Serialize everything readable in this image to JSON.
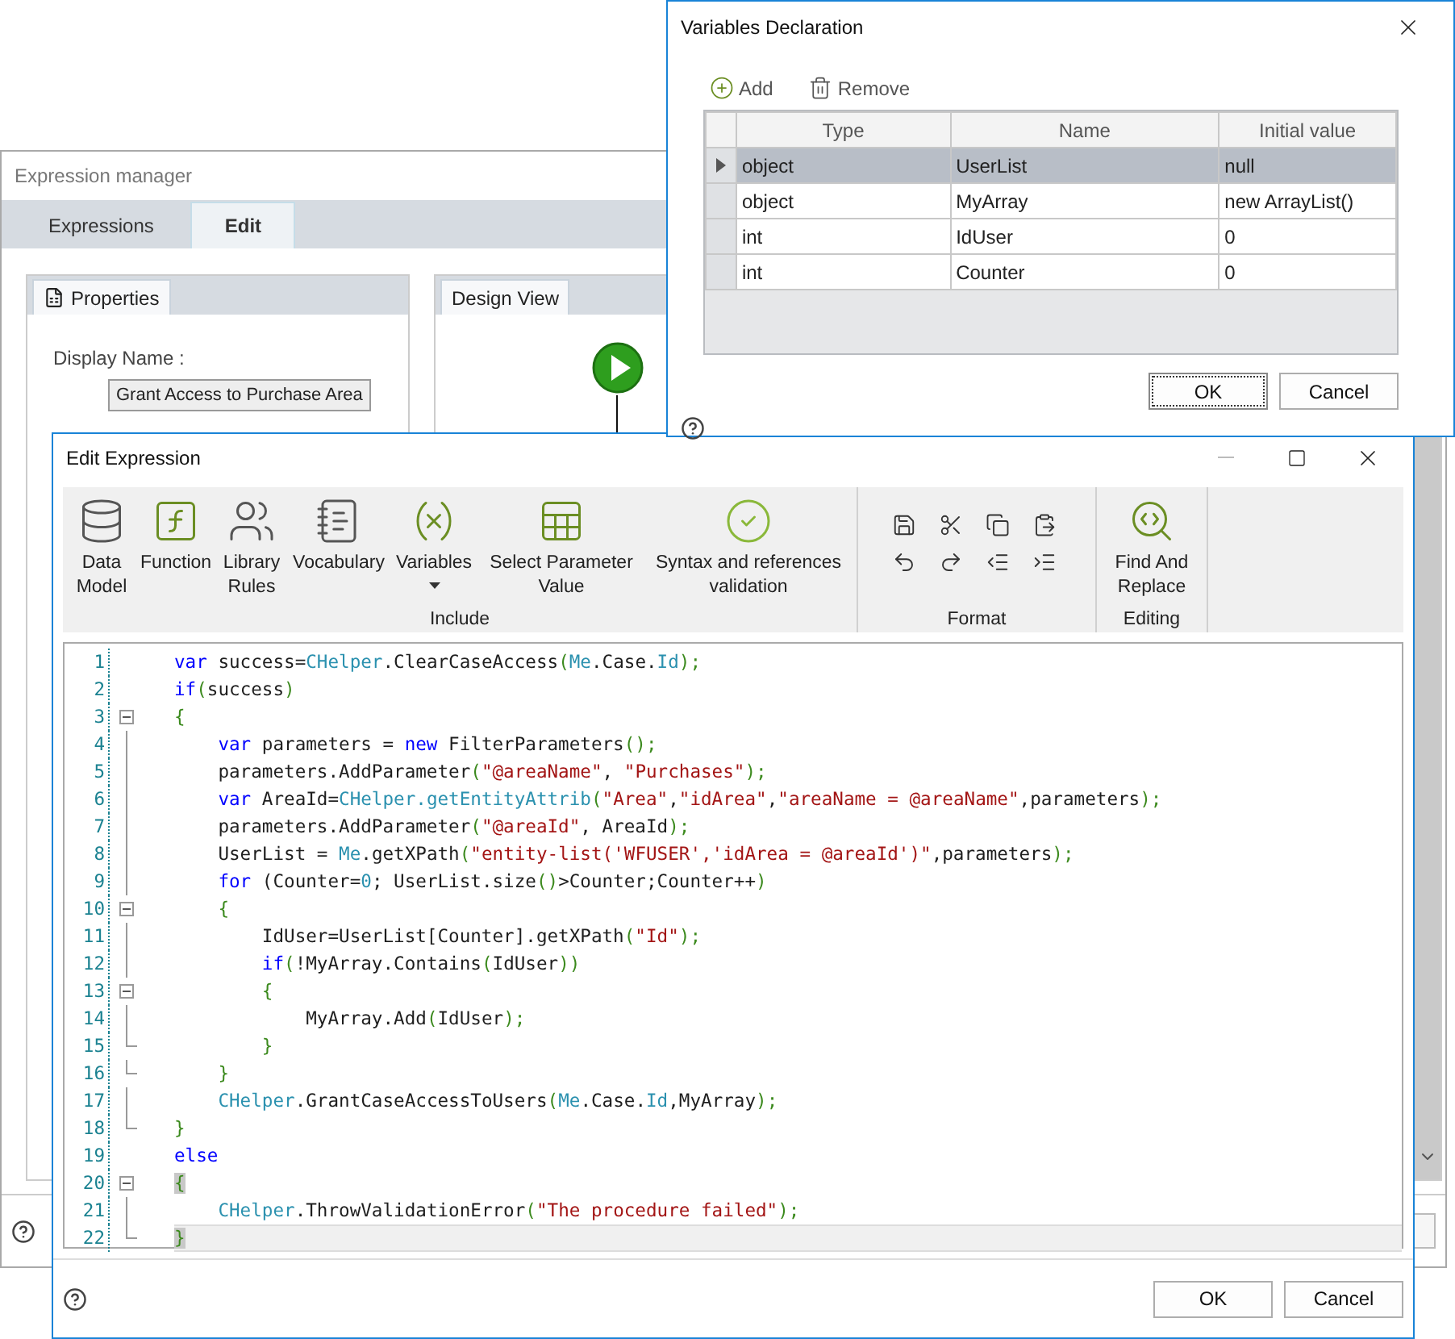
{
  "expression_manager": {
    "title": "Expression manager",
    "tabs": [
      {
        "label": "Expressions",
        "selected": false
      },
      {
        "label": "Edit",
        "selected": true
      }
    ],
    "properties_panel": {
      "tab": "Properties",
      "display_name_label": "Display Name :",
      "display_name_value": "Grant Access to Purchase Area"
    },
    "design_view": {
      "tab": "Design View"
    }
  },
  "variables_dialog": {
    "title": "Variables Declaration",
    "toolbar": [
      {
        "label": "Add",
        "kind": "add"
      },
      {
        "label": "Remove",
        "kind": "remove"
      }
    ],
    "columns": [
      "Type",
      "Name",
      "Initial value"
    ],
    "rows": [
      {
        "type": "object",
        "name": "UserList",
        "initial_value": "null",
        "selected": true
      },
      {
        "type": "object",
        "name": "MyArray",
        "initial_value": "new ArrayList()",
        "selected": false
      },
      {
        "type": "int",
        "name": "IdUser",
        "initial_value": "0",
        "selected": false
      },
      {
        "type": "int",
        "name": "Counter",
        "initial_value": "0",
        "selected": false
      }
    ],
    "buttons": [
      {
        "label": "OK",
        "focused": true
      },
      {
        "label": "Cancel",
        "focused": false
      }
    ]
  },
  "edit_expression": {
    "title": "Edit Expression",
    "ribbon": [
      {
        "label": "Include",
        "kind": "large",
        "items": [
          {
            "label": "Data Model",
            "kind": "data-model",
            "dropdown": false
          },
          {
            "label": "Function",
            "kind": "function",
            "dropdown": false
          },
          {
            "label": "Library Rules",
            "kind": "library",
            "dropdown": false
          },
          {
            "label": "Vocabulary",
            "kind": "vocabulary",
            "dropdown": false
          },
          {
            "label": "Variables",
            "kind": "variables",
            "dropdown": true
          },
          {
            "label": "Select Parameter Value",
            "kind": "parameter",
            "dropdown": false
          },
          {
            "label": "Syntax and references validation",
            "kind": "validation",
            "dropdown": false
          }
        ]
      },
      {
        "label": "Format",
        "kind": "small",
        "items": [
          {
            "kind": "save"
          },
          {
            "kind": "cut"
          },
          {
            "kind": "copy"
          },
          {
            "kind": "paste"
          },
          {
            "kind": "undo"
          },
          {
            "kind": "redo"
          },
          {
            "kind": "outdent"
          },
          {
            "kind": "indent"
          }
        ]
      },
      {
        "label": "Editing",
        "kind": "large",
        "items": [
          {
            "label": "Find And Replace",
            "kind": "find",
            "dropdown": false
          }
        ]
      }
    ],
    "code_lines": [
      {
        "number": "1",
        "kind": "plain",
        "current": false,
        "tokens": [
          {
            "kind": "keyword",
            "text": "var"
          },
          {
            "kind": "plain",
            "text": " success="
          },
          {
            "kind": "member",
            "text": "CHelper"
          },
          {
            "kind": "plain",
            "text": ".ClearCaseAccess"
          },
          {
            "kind": "punct",
            "text": "("
          },
          {
            "kind": "member",
            "text": "Me"
          },
          {
            "kind": "plain",
            "text": ".Case."
          },
          {
            "kind": "member",
            "text": "Id"
          },
          {
            "kind": "punct",
            "text": ");"
          }
        ]
      },
      {
        "number": "2",
        "kind": "plain",
        "current": false,
        "tokens": [
          {
            "kind": "keyword",
            "text": "if"
          },
          {
            "kind": "punct",
            "text": "("
          },
          {
            "kind": "plain",
            "text": "success"
          },
          {
            "kind": "punct",
            "text": ")"
          }
        ]
      },
      {
        "number": "3",
        "kind": "fold-start",
        "current": false,
        "tokens": [
          {
            "kind": "punct",
            "text": "{"
          }
        ]
      },
      {
        "number": "4",
        "kind": "fold-body",
        "current": false,
        "tokens": [
          {
            "kind": "keyword",
            "text": "    var"
          },
          {
            "kind": "plain",
            "text": " parameters = "
          },
          {
            "kind": "keyword",
            "text": "new"
          },
          {
            "kind": "plain",
            "text": " FilterParameters"
          },
          {
            "kind": "punct",
            "text": "();"
          }
        ]
      },
      {
        "number": "5",
        "kind": "fold-body",
        "current": false,
        "tokens": [
          {
            "kind": "plain",
            "text": "    parameters.AddParameter"
          },
          {
            "kind": "punct",
            "text": "("
          },
          {
            "kind": "string",
            "text": "\"@areaName\""
          },
          {
            "kind": "plain",
            "text": ", "
          },
          {
            "kind": "string",
            "text": "\"Purchases\""
          },
          {
            "kind": "punct",
            "text": ");"
          }
        ]
      },
      {
        "number": "6",
        "kind": "fold-body",
        "current": false,
        "tokens": [
          {
            "kind": "keyword",
            "text": "    var"
          },
          {
            "kind": "plain",
            "text": " AreaId="
          },
          {
            "kind": "member",
            "text": "CHelper.getEntityAttrib"
          },
          {
            "kind": "punct",
            "text": "("
          },
          {
            "kind": "string",
            "text": "\"Area\""
          },
          {
            "kind": "plain",
            "text": ","
          },
          {
            "kind": "string",
            "text": "\"idArea\""
          },
          {
            "kind": "plain",
            "text": ","
          },
          {
            "kind": "string",
            "text": "\"areaName = @areaName\""
          },
          {
            "kind": "plain",
            "text": ",parameters"
          },
          {
            "kind": "punct",
            "text": ");"
          }
        ]
      },
      {
        "number": "7",
        "kind": "fold-body",
        "current": false,
        "tokens": [
          {
            "kind": "plain",
            "text": "    parameters.AddParameter"
          },
          {
            "kind": "punct",
            "text": "("
          },
          {
            "kind": "string",
            "text": "\"@areaId\""
          },
          {
            "kind": "plain",
            "text": ", AreaId"
          },
          {
            "kind": "punct",
            "text": ");"
          }
        ]
      },
      {
        "number": "8",
        "kind": "fold-body",
        "current": false,
        "tokens": [
          {
            "kind": "plain",
            "text": "    UserList = "
          },
          {
            "kind": "member",
            "text": "Me"
          },
          {
            "kind": "plain",
            "text": ".getXPath"
          },
          {
            "kind": "punct",
            "text": "("
          },
          {
            "kind": "string",
            "text": "\"entity-list('WFUSER','idArea = @areaId')\""
          },
          {
            "kind": "plain",
            "text": ",parameters"
          },
          {
            "kind": "punct",
            "text": ");"
          }
        ]
      },
      {
        "number": "9",
        "kind": "fold-body",
        "current": false,
        "tokens": [
          {
            "kind": "keyword",
            "text": "    for"
          },
          {
            "kind": "plain",
            "text": " (Counter="
          },
          {
            "kind": "member",
            "text": "0"
          },
          {
            "kind": "plain",
            "text": "; UserList.size"
          },
          {
            "kind": "punct",
            "text": "()"
          },
          {
            "kind": "plain",
            "text": ">Counter;Counter++"
          },
          {
            "kind": "punct",
            "text": ")"
          }
        ]
      },
      {
        "number": "10",
        "kind": "fold-start",
        "current": false,
        "tokens": [
          {
            "kind": "punct",
            "text": "    {"
          }
        ]
      },
      {
        "number": "11",
        "kind": "fold-body",
        "current": false,
        "tokens": [
          {
            "kind": "plain",
            "text": "        IdUser=UserList[Counter].getXPath"
          },
          {
            "kind": "punct",
            "text": "("
          },
          {
            "kind": "string",
            "text": "\"Id\""
          },
          {
            "kind": "punct",
            "text": ");"
          }
        ]
      },
      {
        "number": "12",
        "kind": "fold-body",
        "current": false,
        "tokens": [
          {
            "kind": "keyword",
            "text": "        if"
          },
          {
            "kind": "punct",
            "text": "("
          },
          {
            "kind": "plain",
            "text": "!MyArray.Contains"
          },
          {
            "kind": "punct",
            "text": "("
          },
          {
            "kind": "plain",
            "text": "IdUser"
          },
          {
            "kind": "punct",
            "text": "))"
          }
        ]
      },
      {
        "number": "13",
        "kind": "fold-start",
        "current": false,
        "tokens": [
          {
            "kind": "punct",
            "text": "        {"
          }
        ]
      },
      {
        "number": "14",
        "kind": "fold-body",
        "current": false,
        "tokens": [
          {
            "kind": "plain",
            "text": "            MyArray.Add"
          },
          {
            "kind": "punct",
            "text": "("
          },
          {
            "kind": "plain",
            "text": "IdUser"
          },
          {
            "kind": "punct",
            "text": ");"
          }
        ]
      },
      {
        "number": "15",
        "kind": "fold-end",
        "current": false,
        "tokens": [
          {
            "kind": "punct",
            "text": "        }"
          }
        ]
      },
      {
        "number": "16",
        "kind": "fold-end",
        "current": false,
        "tokens": [
          {
            "kind": "punct",
            "text": "    }"
          }
        ]
      },
      {
        "number": "17",
        "kind": "fold-body",
        "current": false,
        "tokens": [
          {
            "kind": "member",
            "text": "    CHelper"
          },
          {
            "kind": "plain",
            "text": ".GrantCaseAccessToUsers"
          },
          {
            "kind": "punct",
            "text": "("
          },
          {
            "kind": "member",
            "text": "Me"
          },
          {
            "kind": "plain",
            "text": ".Case."
          },
          {
            "kind": "member",
            "text": "Id"
          },
          {
            "kind": "plain",
            "text": ",MyArray"
          },
          {
            "kind": "punct",
            "text": ");"
          }
        ]
      },
      {
        "number": "18",
        "kind": "fold-end",
        "current": false,
        "tokens": [
          {
            "kind": "punct",
            "text": "}"
          }
        ]
      },
      {
        "number": "19",
        "kind": "plain",
        "current": false,
        "tokens": [
          {
            "kind": "keyword",
            "text": "else"
          }
        ]
      },
      {
        "number": "20",
        "kind": "fold-start",
        "current": false,
        "tokens": [
          {
            "kind": "match",
            "text": "{"
          }
        ]
      },
      {
        "number": "21",
        "kind": "fold-body",
        "current": false,
        "tokens": [
          {
            "kind": "member",
            "text": "    CHelper"
          },
          {
            "kind": "plain",
            "text": ".ThrowValidationError"
          },
          {
            "kind": "punct",
            "text": "("
          },
          {
            "kind": "string",
            "text": "\"The procedure failed\""
          },
          {
            "kind": "punct",
            "text": ");"
          }
        ]
      },
      {
        "number": "22",
        "kind": "fold-end",
        "current": true,
        "tokens": [
          {
            "kind": "match",
            "text": "}"
          }
        ]
      }
    ],
    "buttons": [
      "OK",
      "Cancel"
    ]
  }
}
